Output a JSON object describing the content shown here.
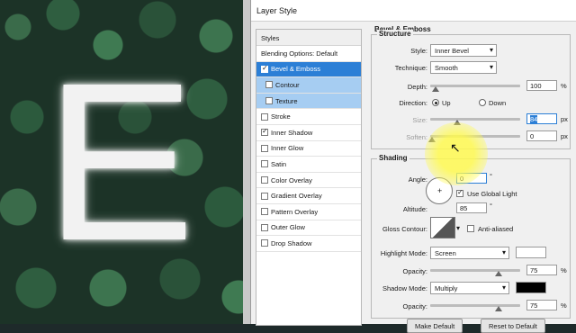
{
  "dialog": {
    "title": "Layer Style"
  },
  "styles_panel": {
    "header": "Styles",
    "items": [
      {
        "label": "Blending Options: Default",
        "checkbox": false,
        "checked": false,
        "state": "normal"
      },
      {
        "label": "Bevel & Emboss",
        "checkbox": true,
        "checked": true,
        "state": "selected"
      },
      {
        "label": "Contour",
        "checkbox": true,
        "checked": false,
        "state": "sub"
      },
      {
        "label": "Texture",
        "checkbox": true,
        "checked": false,
        "state": "sub"
      },
      {
        "label": "Stroke",
        "checkbox": true,
        "checked": false,
        "state": "normal"
      },
      {
        "label": "Inner Shadow",
        "checkbox": true,
        "checked": true,
        "state": "normal"
      },
      {
        "label": "Inner Glow",
        "checkbox": true,
        "checked": false,
        "state": "normal"
      },
      {
        "label": "Satin",
        "checkbox": true,
        "checked": false,
        "state": "normal"
      },
      {
        "label": "Color Overlay",
        "checkbox": true,
        "checked": false,
        "state": "normal"
      },
      {
        "label": "Gradient Overlay",
        "checkbox": true,
        "checked": false,
        "state": "normal"
      },
      {
        "label": "Pattern Overlay",
        "checkbox": true,
        "checked": false,
        "state": "normal"
      },
      {
        "label": "Outer Glow",
        "checkbox": true,
        "checked": false,
        "state": "normal"
      },
      {
        "label": "Drop Shadow",
        "checkbox": true,
        "checked": false,
        "state": "normal"
      }
    ]
  },
  "bevel": {
    "section_title": "Bevel & Emboss",
    "structure_title": "Structure",
    "style_label": "Style:",
    "style_value": "Inner Bevel",
    "technique_label": "Technique:",
    "technique_value": "Smooth",
    "depth_label": "Depth:",
    "depth_value": "100",
    "depth_unit": "%",
    "direction_label": "Direction:",
    "direction_up": "Up",
    "direction_down": "Down",
    "size_label": "Size:",
    "size_value": "84",
    "size_unit": "px",
    "soften_label": "Soften:",
    "soften_value": "0",
    "soften_unit": "px"
  },
  "shading": {
    "title": "Shading",
    "angle_label": "Angle:",
    "angle_value": "0",
    "angle_unit": "°",
    "use_global_light": "Use Global Light",
    "altitude_label": "Altitude:",
    "altitude_value": "85",
    "altitude_unit": "°",
    "gloss_label": "Gloss Contour:",
    "anti_aliased": "Anti-aliased",
    "highlight_mode_label": "Highlight Mode:",
    "highlight_mode_value": "Screen",
    "highlight_opacity_label": "Opacity:",
    "highlight_opacity_value": "75",
    "highlight_opacity_unit": "%",
    "shadow_mode_label": "Shadow Mode:",
    "shadow_mode_value": "Multiply",
    "shadow_opacity_label": "Opacity:",
    "shadow_opacity_value": "75",
    "shadow_opacity_unit": "%"
  },
  "buttons": {
    "make_default": "Make Default",
    "reset_default": "Reset to Default"
  },
  "canvas": {
    "letter": "E"
  },
  "colors": {
    "selected": "#2c7fd6",
    "sub_selected": "#a6cdf2",
    "highlight_swatch": "#ffffff",
    "shadow_swatch": "#000000"
  }
}
